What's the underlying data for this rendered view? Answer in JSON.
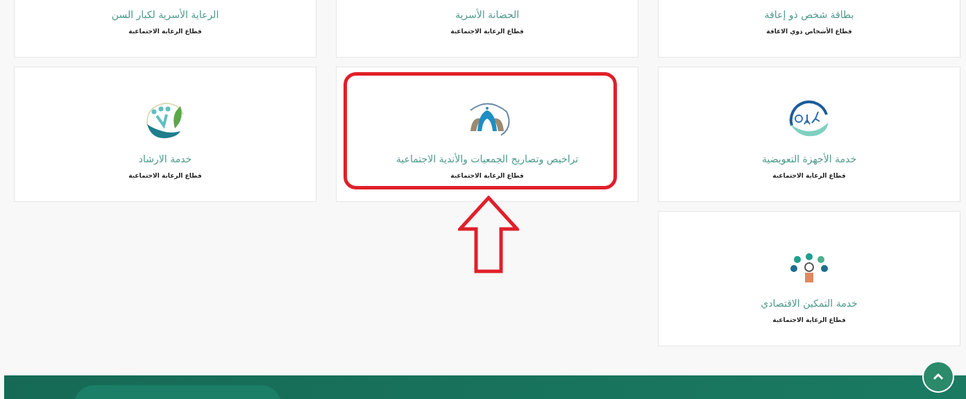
{
  "cards": [
    {
      "title": "بطاقة شخص ذو إعاقة",
      "sector": "قطاع الأشخاص ذوي الاعاقة",
      "highlighted": false
    },
    {
      "title": "الحضانة الأسرية",
      "sector": "قطاع الرعاية الاجتماعية",
      "highlighted": false
    },
    {
      "title": "الرعاية الأسرية لكبار السن",
      "sector": "قطاع الرعاية الاجتماعية",
      "highlighted": false
    },
    {
      "title": "خدمة الأجهزة التعويضية",
      "sector": "قطاع الرعاية الاجتماعية",
      "highlighted": false,
      "kind": "mobility"
    },
    {
      "title": "تراخيص وتصاريح الجمعيات والأندية الاجتماعية",
      "sector": "قطاع الرعاية الاجتماعية",
      "highlighted": true,
      "kind": "arches"
    },
    {
      "title": "خدمة الارشاد",
      "sector": "قطاع الرعاية الاجتماعية",
      "highlighted": false,
      "kind": "hand-leaf"
    },
    {
      "title": "خدمة التمكين الاقتصادي",
      "sector": "قطاع الرعاية الاجتماعية",
      "highlighted": false,
      "kind": "network"
    }
  ]
}
